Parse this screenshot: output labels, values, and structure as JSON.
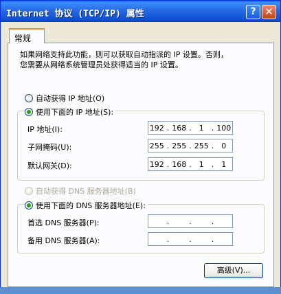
{
  "window": {
    "title": "Internet 协议 (TCP/IP) 属性"
  },
  "titlebar": {
    "help_label": "?",
    "close_label": "✕"
  },
  "tabs": [
    {
      "label": "常规"
    }
  ],
  "description": "如果网络支持此功能，则可以获取自动指派的 IP 设置。否则，\n您需要从网络系统管理员处获得适当的 IP 设置。",
  "ip": {
    "auto_label": "自动获得 IP 地址(O)",
    "manual_label": "使用下面的 IP 地址(S):",
    "selected": "manual",
    "fields": [
      {
        "label": "IP 地址(I):",
        "octets": [
          "192",
          "168",
          "1",
          "100"
        ]
      },
      {
        "label": "子网掩码(U):",
        "octets": [
          "255",
          "255",
          "255",
          "0"
        ]
      },
      {
        "label": "默认网关(D):",
        "octets": [
          "192",
          "168",
          "1",
          "1"
        ]
      }
    ]
  },
  "dns": {
    "auto_label": "自动获得 DNS 服务器地址(B)",
    "manual_label": "使用下面的 DNS 服务器地址(E):",
    "selected": "manual",
    "auto_disabled": true,
    "fields": [
      {
        "label": "首选 DNS 服务器(P):",
        "octets": [
          "",
          "",
          "",
          ""
        ]
      },
      {
        "label": "备用 DNS 服务器(A):",
        "octets": [
          "",
          "",
          "",
          ""
        ]
      }
    ]
  },
  "buttons": {
    "advanced_label": "高级(V)..."
  }
}
